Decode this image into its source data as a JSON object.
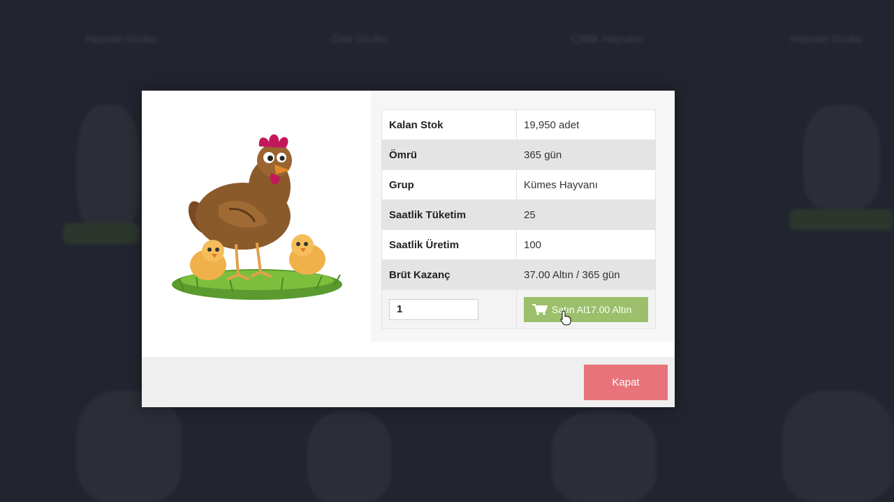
{
  "background": {
    "titles": [
      "Hayvan Grubu",
      "Zirai Grubu",
      "Çiftlik Hayvanı",
      "Hayvan Grubu"
    ]
  },
  "details": {
    "rows": [
      {
        "label": "Kalan Stok",
        "value": "19,950 adet"
      },
      {
        "label": "Ömrü",
        "value": "365 gün"
      },
      {
        "label": "Grup",
        "value": "Kümes Hayvanı"
      },
      {
        "label": "Saatlik Tüketim",
        "value": "25"
      },
      {
        "label": "Saatlik Üretim",
        "value": "100"
      },
      {
        "label": "Brüt Kazanç",
        "value": "37.00 Altın / 365 gün"
      }
    ],
    "quantity": "1",
    "buy_label": "Satın Al17.00 Altın"
  },
  "footer": {
    "close_label": "Kapat"
  },
  "icons": {
    "cart": "shopping-cart-icon",
    "cursor": "hand-pointer-icon"
  },
  "colors": {
    "buy": "#9bbf6a",
    "close": "#e8737a",
    "backdrop": "#2a2d3a"
  }
}
